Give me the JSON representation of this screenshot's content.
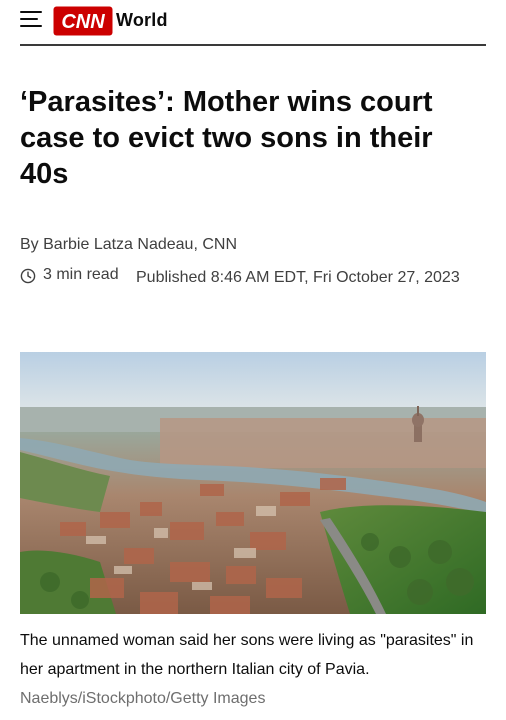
{
  "header": {
    "brand": "CNN",
    "section": "World",
    "brand_color": "#cc0000"
  },
  "article": {
    "headline": "‘Parasites’: Mother wins court case to evict two sons in their 40s",
    "byline": "By Barbie Latza Nadeau, CNN",
    "read_time": "3 min read",
    "published": "Published 8:46 AM EDT, Fri October 27, 2023"
  },
  "image": {
    "caption": "The unnamed woman said her sons were living as \"parasites\" in her apartment in the northern Italian city of Pavia.",
    "credit": "Naeblys/iStockphoto/Getty Images"
  },
  "icons": {
    "menu": "hamburger-menu-icon",
    "clock": "clock-icon"
  }
}
